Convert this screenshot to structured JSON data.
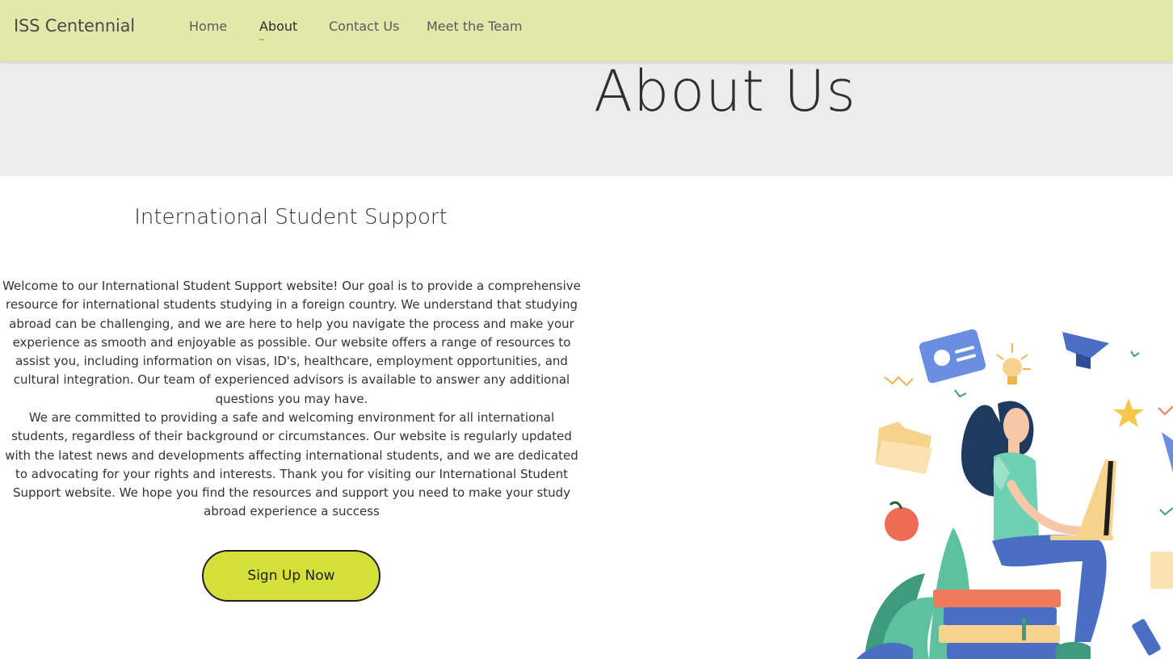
{
  "navbar": {
    "brand": "ISS Centennial",
    "links": [
      {
        "label": "Home",
        "active": false
      },
      {
        "label": "About",
        "active": true
      },
      {
        "label": "Contact Us",
        "active": false
      },
      {
        "label": "Meet the Team",
        "active": false
      }
    ],
    "background": "#e2e8aa"
  },
  "hero": {
    "title": "About Us",
    "background": "#ececec"
  },
  "main": {
    "section_title": "International Student Support",
    "paragraphs": [
      "Welcome to our International Student Support website! Our goal is to provide a comprehensive resource for international students studying in a foreign country. We understand that studying abroad can be challenging, and we are here to help you navigate the process and make your experience as smooth and enjoyable as possible. Our website offers a range of resources to assist you, including information on visas, ID's, healthcare, employment opportunities, and cultural integration. Our team of experienced advisors is available to answer any additional questions you may have.",
      "We are committed to providing a safe and welcoming environment for all international students, regardless of their background or circumstances. Our website is regularly updated with the latest news and developments affecting international students, and we are dedicated to advocating for your rights and interests. Thank you for visiting our International Student Support website. We hope you find the resources and support you need to make your study abroad experience a success"
    ],
    "cta_label": "Sign Up Now",
    "cta_color": "#d4df3a"
  },
  "illustration": {
    "subject": "student-with-laptop-on-books-illustration"
  }
}
